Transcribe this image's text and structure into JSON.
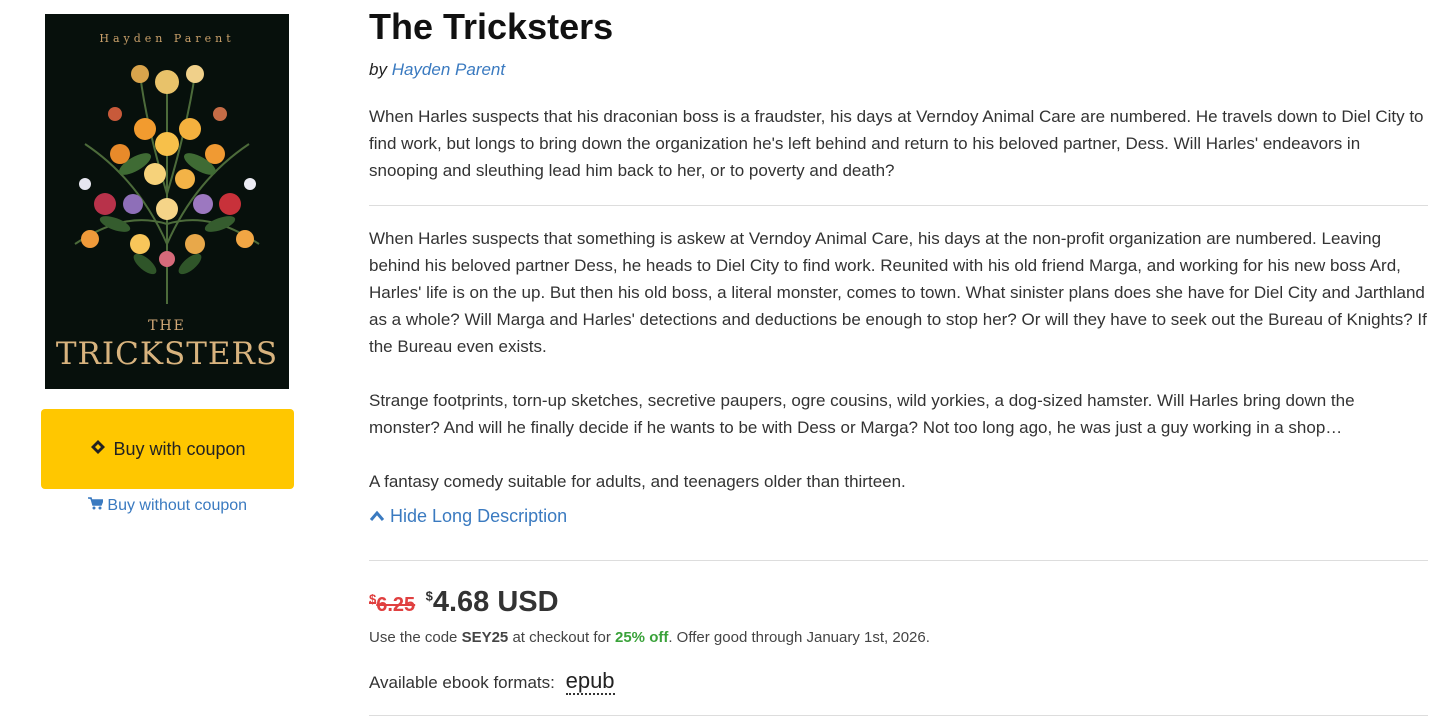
{
  "cover": {
    "author_text": "Hayden Parent",
    "the_text": "THE",
    "title_text": "TRICKSTERS"
  },
  "actions": {
    "buy_coupon_label": "Buy with coupon",
    "buy_no_coupon_label": "Buy without coupon"
  },
  "book": {
    "title": "The Tricksters",
    "by_label": "by",
    "author": "Hayden Parent",
    "short_description": "When Harles suspects that his draconian boss is a fraudster, his days at Verndoy Animal Care are numbered. He travels down to Diel City to find work, but longs to bring down the organization he's left behind and return to his beloved partner, Dess. Will Harles' endeavors in snooping and sleuthing lead him back to her, or to poverty and death?",
    "long_description": [
      "When Harles suspects that something is askew at Verndoy Animal Care, his days at the non-profit organization are numbered. Leaving behind his beloved partner Dess, he heads to Diel City to find work. Reunited with his old friend Marga, and working for his new boss Ard, Harles' life is on the up. But then his old boss, a literal monster, comes to town. What sinister plans does she have for Diel City and Jarthland as a whole? Will Marga and Harles' detections and deductions be enough to stop her? Or will they have to seek out the Bureau of Knights? If the Bureau even exists.",
      "Strange footprints, torn-up sketches, secretive paupers, ogre cousins, wild yorkies, a dog-sized hamster. Will Harles bring down the monster? And will he finally decide if he wants to be with Dess or Marga? Not too long ago, he was just a guy working in a shop…",
      "A fantasy comedy suitable for adults, and teenagers older than thirteen."
    ],
    "toggle_label": "Hide Long Description"
  },
  "pricing": {
    "currency_symbol": "$",
    "old_price": "6.25",
    "new_price": "4.68 USD",
    "code_prefix": "Use the code",
    "code": "SEY25",
    "code_mid": "at checkout for",
    "discount": "25% off",
    "code_suffix": ". Offer good through January 1st, 2026."
  },
  "formats": {
    "label": "Available ebook formats:",
    "items": [
      "epub"
    ]
  },
  "colors": {
    "accent_yellow": "#ffc700",
    "link_blue": "#3a7ac0",
    "old_price_red": "#e04040",
    "discount_green": "#3aa23a"
  }
}
